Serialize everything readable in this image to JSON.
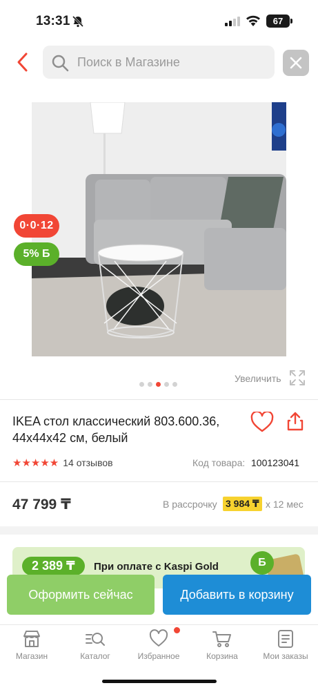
{
  "status_bar": {
    "time": "13:31",
    "battery": "67"
  },
  "search": {
    "placeholder": "Поиск в Магазине"
  },
  "badges": {
    "installment": "0·0·12",
    "bonus": "5% Б"
  },
  "gallery": {
    "zoom_label": "Увеличить",
    "images_total": 5,
    "active_index": 2
  },
  "product": {
    "title": "IKEA стол классический 803.600.36, 44x44x42 см, белый",
    "rating_stars": 5,
    "stars": "★★★★★",
    "reviews": "14 отзывов",
    "sku_label": "Код товара:",
    "sku": "100123041",
    "price": "47 799 ₸",
    "installment_label": "В рассрочку",
    "installment_value": "3 984 ₸",
    "installment_term": "х 12 мес"
  },
  "promo": {
    "amount": "2 389 ₸",
    "text": "При оплате с Kaspi Gold",
    "coin": "Б"
  },
  "actions": {
    "buy_now": "Оформить сейчас",
    "add_to_cart": "Добавить в корзину"
  },
  "tabs": [
    {
      "label": "Магазин",
      "icon": "store-icon"
    },
    {
      "label": "Каталог",
      "icon": "catalog-search-icon"
    },
    {
      "label": "Избранное",
      "icon": "heart-icon"
    },
    {
      "label": "Корзина",
      "icon": "cart-icon"
    },
    {
      "label": "Мои заказы",
      "icon": "orders-icon"
    }
  ],
  "colors": {
    "accent": "#f14635",
    "green": "#5bb02a",
    "blue": "#1e8dd6",
    "light_green": "#8fce67",
    "yellow": "#f7d22f"
  }
}
